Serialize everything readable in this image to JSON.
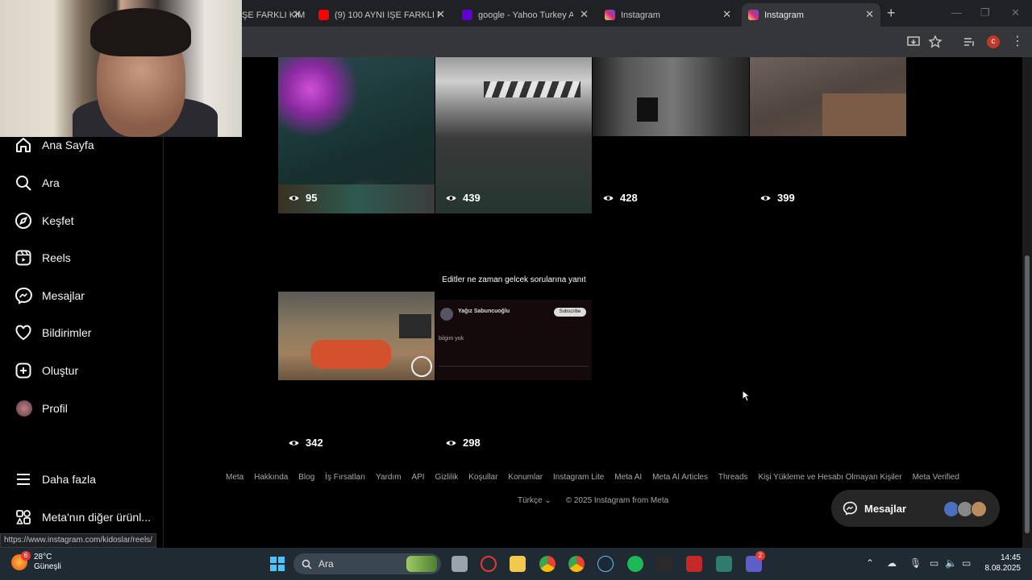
{
  "browser": {
    "tabs": [
      {
        "title": "ŞE FARKLI KİM",
        "favicon": "youtube"
      },
      {
        "title": "(9) 100 AYNI İŞE FARKLI KİM",
        "favicon": "youtube"
      },
      {
        "title": "google - Yahoo Turkey Arar",
        "favicon": "yahoo"
      },
      {
        "title": "Instagram",
        "favicon": "instagram"
      },
      {
        "title": "Instagram",
        "favicon": "instagram",
        "active": true
      }
    ],
    "profile_initial": "c",
    "status_url": "https://www.instagram.com/kidoslar/reels/"
  },
  "sidebar": {
    "items": [
      {
        "label": "Ana Sayfa",
        "icon": "home-icon"
      },
      {
        "label": "Ara",
        "icon": "search-icon"
      },
      {
        "label": "Keşfet",
        "icon": "compass-icon"
      },
      {
        "label": "Reels",
        "icon": "reels-icon"
      },
      {
        "label": "Mesajlar",
        "icon": "messenger-icon"
      },
      {
        "label": "Bildirimler",
        "icon": "heart-icon"
      },
      {
        "label": "Oluştur",
        "icon": "plus-square-icon"
      },
      {
        "label": "Profil",
        "icon": "profile-avatar"
      }
    ],
    "more": {
      "label": "Daha fazla",
      "icon": "menu-icon"
    },
    "meta": {
      "label": "Meta'nın diğer ürünl...",
      "icon": "grid-icon"
    }
  },
  "reels": [
    {
      "views": "95",
      "theme": "game-moba"
    },
    {
      "views": "439",
      "theme": "person-shirt"
    },
    {
      "views": "428",
      "theme": "room-dark"
    },
    {
      "views": "399",
      "theme": "room-desk"
    },
    {
      "views": "342",
      "theme": "game-car"
    },
    {
      "views": "298",
      "theme": "tweet",
      "caption": "Editler ne zaman gelcek sorularına yanıt",
      "tweet": {
        "author": "Yağız Sabuncuoğlu",
        "button": "Subscribe",
        "text": "bilgim yok"
      }
    }
  ],
  "footer": {
    "links": [
      "Meta",
      "Hakkında",
      "Blog",
      "İş Fırsatları",
      "Yardım",
      "API",
      "Gizlilik",
      "Koşullar",
      "Konumlar",
      "Instagram Lite",
      "Meta AI",
      "Meta AI Articles",
      "Threads",
      "Kişi Yükleme ve Hesabı Olmayan Kişiler",
      "Meta Verified"
    ],
    "language": "Türkçe",
    "copyright": "© 2025 Instagram from Meta"
  },
  "messages_pill": {
    "label": "Mesajlar"
  },
  "taskbar": {
    "weather_temp": "28°C",
    "weather_desc": "Güneşli",
    "weather_badge": "6",
    "search_placeholder": "Ara",
    "teams_badge": "2",
    "time": "14:45",
    "date": "8.08.2025"
  },
  "colors": {
    "background": "#000000",
    "sidebar_border": "#262626",
    "footer_text": "#a8a8a8",
    "pill_bg": "#262626"
  }
}
